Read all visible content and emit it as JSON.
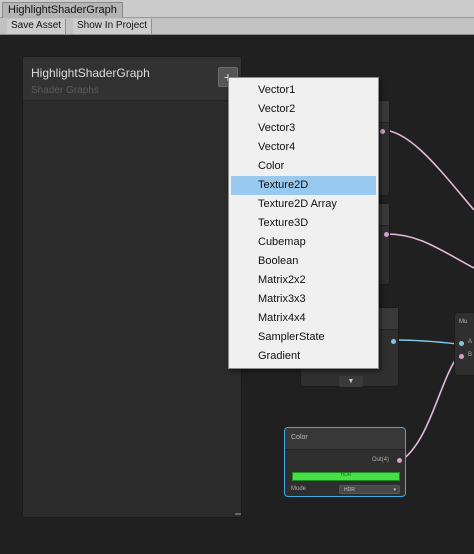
{
  "window": {
    "tab_title": "HighlightShaderGraph"
  },
  "toolbar": {
    "save_asset": "Save Asset",
    "show_in_project": "Show In Project"
  },
  "blackboard": {
    "title": "HighlightShaderGraph",
    "subtitle": "Shader Graphs",
    "add_button": "+"
  },
  "property_menu": {
    "items": [
      "Vector1",
      "Vector2",
      "Vector3",
      "Vector4",
      "Color",
      "Texture2D",
      "Texture2D Array",
      "Texture3D",
      "Cubemap",
      "Boolean",
      "Matrix2x2",
      "Matrix3x3",
      "Matrix4x4",
      "SamplerState",
      "Gradient"
    ],
    "selected": "Texture2D"
  },
  "color_node": {
    "title": "Color",
    "output_label": "Out(4)",
    "hdr_label": "HDR",
    "mode_label": "Mode",
    "mode_value": "HDR",
    "swatch_color": "#44e146"
  },
  "multiply_node": {
    "title_fragment": "Mu",
    "port_a": "A",
    "port_b": "B"
  },
  "colors": {
    "selection": "#99c9ef",
    "active_border": "#3fa9e6",
    "edge_pink": "#e6b8d8",
    "edge_blue": "#7ec8e6"
  }
}
